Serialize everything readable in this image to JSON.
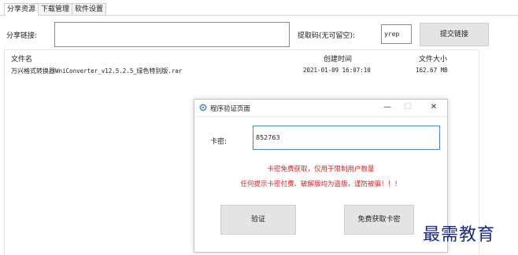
{
  "tabs": [
    "分享资源",
    "下载管理",
    "软件设置"
  ],
  "share": {
    "link_label": "分享链接:",
    "link_value": "",
    "code_label": "提取码(无可留空):",
    "code_value": "yrep",
    "submit_label": "提交链接"
  },
  "file_list": {
    "columns": [
      "文件名",
      "创建时间",
      "文件大小"
    ],
    "rows": [
      {
        "name_prefix": "万兴格式转换器",
        "name_latin": "WniConverter_v12.5.2.5",
        "name_suffix": "_绿色特别版",
        "name_ext": ".rar",
        "created": "2021-01-09 16:07:10",
        "size": "162.67 MB"
      }
    ]
  },
  "dialog": {
    "title": "程序验证页面",
    "minimize_glyph": "—",
    "maximize_glyph": "☐",
    "close_glyph": "✕",
    "key_label": "卡密:",
    "key_value": "852763",
    "note_line1": "卡密免费获取，仅用于限制用户数量",
    "note_line2": "任何提示卡密付费、破解版均为盗版，谨防被骗！！！",
    "verify_label": "验证",
    "get_key_label": "免费获取卡密"
  },
  "watermark": "最需教育",
  "icons": {
    "dialog_icon": "app-logo-icon"
  },
  "colors": {
    "accent_border": "#4f86c6",
    "warning_text": "#e02020",
    "watermark_text": "#1a2a7a"
  }
}
